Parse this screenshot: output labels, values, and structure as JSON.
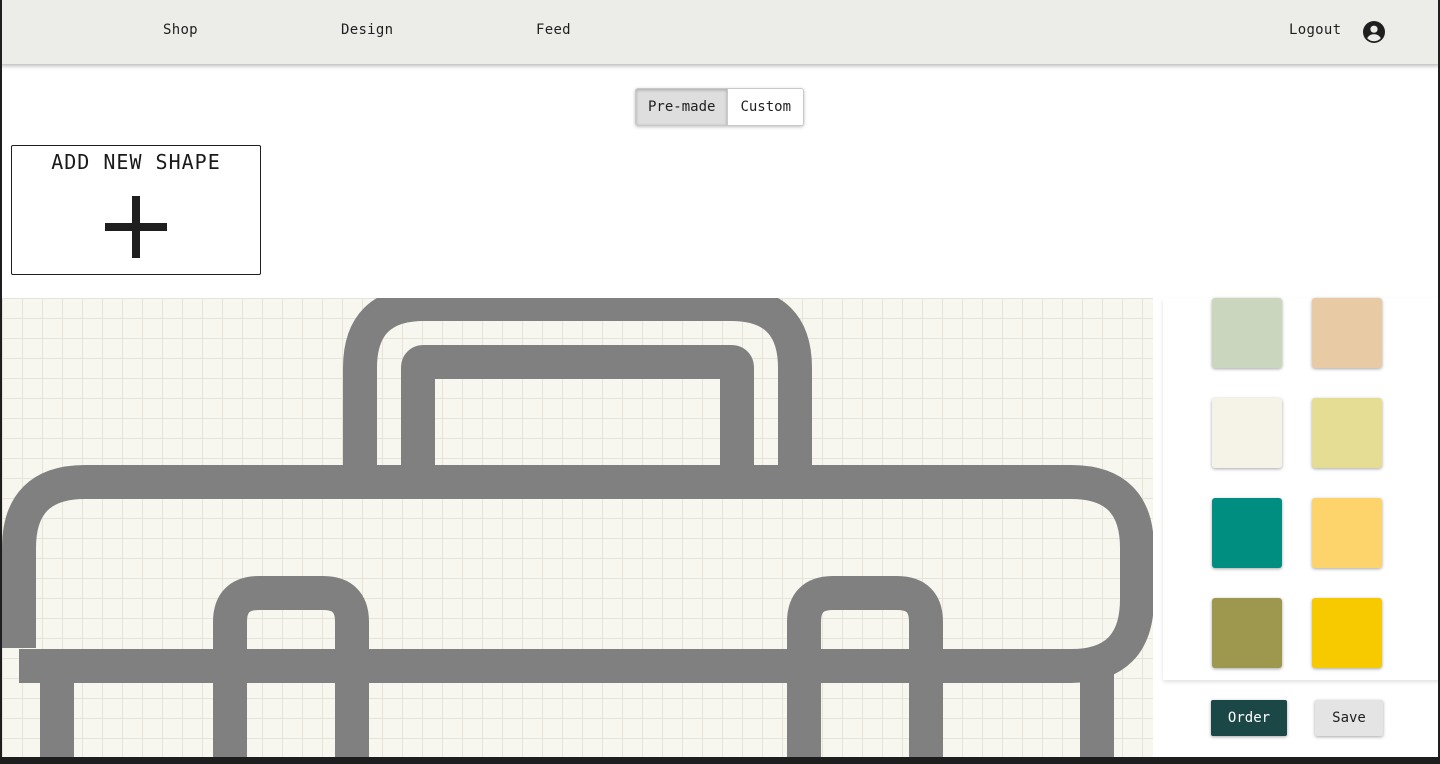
{
  "nav": {
    "links": [
      "Shop",
      "Design",
      "Feed"
    ],
    "logout_label": "Logout",
    "account_icon": "account-circle-icon"
  },
  "mode_toggle": {
    "options": [
      "Pre-made",
      "Custom"
    ],
    "selected": "Pre-made"
  },
  "add_shape": {
    "title": "ADD NEW SHAPE",
    "icon": "plus-icon"
  },
  "canvas": {
    "shape_color": "#808080",
    "background_color": "#f8f7ef"
  },
  "palette": {
    "colors": [
      "#cad6be",
      "#e8cba4",
      "#f5f3e8",
      "#e4dd93",
      "#008e80",
      "#fdd36b",
      "#9e984f",
      "#f7ca00"
    ]
  },
  "actions": {
    "order_label": "Order",
    "save_label": "Save"
  },
  "colors": {
    "navbar_bg": "#ecede8",
    "order_bg": "#1c4747",
    "save_bg": "#e4e4e4"
  }
}
